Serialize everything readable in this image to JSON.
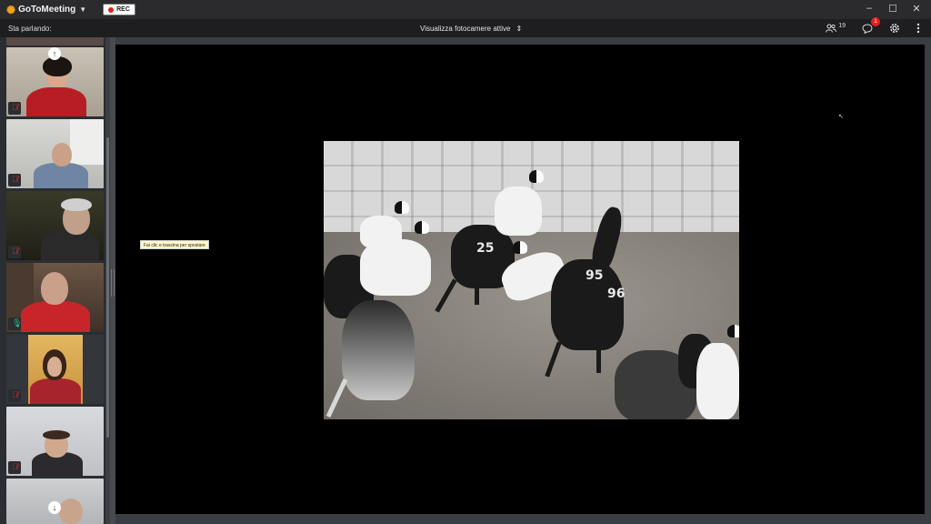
{
  "app": {
    "name": "GoToMeeting",
    "rec_label": "REC"
  },
  "window": {
    "minimize": "–",
    "maximize": "☐",
    "close": "✕"
  },
  "toolbar": {
    "speaking_label": "Sta parlando:",
    "camera_view_label": "Visualizza fotocamere attive",
    "attendee_count": "19",
    "chat_badge": "1"
  },
  "tooltip": {
    "text": "Fai clic e trascina per spostare"
  },
  "shared_content": {
    "bib_numbers": [
      "25",
      "95",
      "96"
    ]
  },
  "colors": {
    "titlebar": "#2b2b2d",
    "toolbar": "#1e1e20",
    "sidebar": "#2a2d31",
    "muted": "#e03030",
    "speaking": "#2ec27e",
    "accent_logo": "#f7a21b",
    "rec_dot": "#e02020"
  },
  "icons": {
    "logo": "gotomeeting-flower-icon",
    "attendees": "people-icon",
    "chat": "chat-bubble-icon",
    "settings": "gear-icon",
    "more": "more-vertical-icon",
    "scroll_up": "arrow-up-icon",
    "scroll_down": "arrow-down-icon",
    "mic_muted": "mic-muted-icon",
    "mic_active": "mic-icon"
  },
  "participants": [
    {
      "status": "muted"
    },
    {
      "status": "muted"
    },
    {
      "status": "muted"
    },
    {
      "status": "speaking"
    },
    {
      "status": "muted"
    },
    {
      "status": "muted"
    },
    {
      "status": "none"
    }
  ]
}
